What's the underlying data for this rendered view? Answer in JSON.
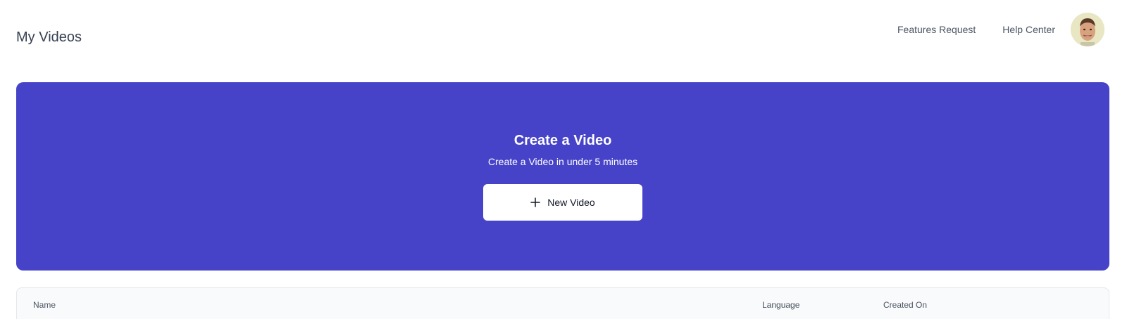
{
  "header": {
    "title": "My Videos",
    "nav": {
      "features_request": "Features Request",
      "help_center": "Help Center"
    }
  },
  "hero": {
    "title": "Create a Video",
    "subtitle": "Create a Video in under 5 minutes",
    "button_label": "New Video",
    "button_icon": "plus-icon",
    "background_color": "#4643c8"
  },
  "table": {
    "columns": [
      "Name",
      "Language",
      "Created On"
    ]
  }
}
